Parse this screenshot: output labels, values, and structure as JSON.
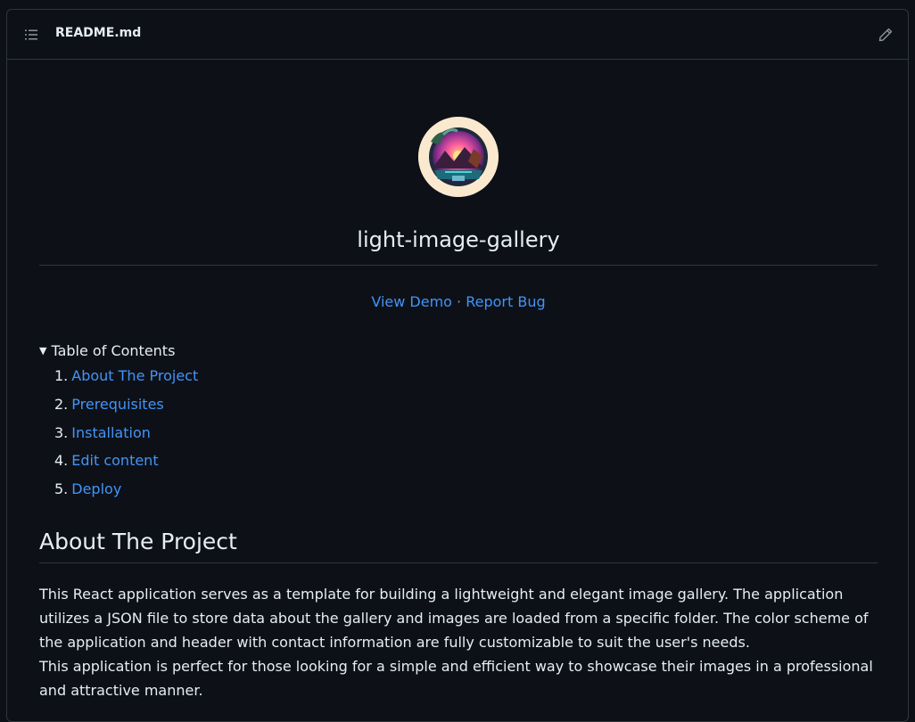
{
  "header": {
    "file_name": "README.md"
  },
  "project": {
    "title": "light-image-gallery",
    "view_demo": "View Demo",
    "separator": " · ",
    "report_bug": "Report Bug"
  },
  "toc": {
    "summary": "Table of Contents",
    "items": [
      {
        "num": "1.",
        "label": "About The Project"
      },
      {
        "num": "2.",
        "label": "Prerequisites"
      },
      {
        "num": "3.",
        "label": "Installation"
      },
      {
        "num": "4.",
        "label": "Edit content"
      },
      {
        "num": "5.",
        "label": "Deploy"
      }
    ]
  },
  "about": {
    "heading": "About The Project",
    "paragraph_1": "This React application serves as a template for building a lightweight and elegant image gallery. The application utilizes a JSON file to store data about the gallery and images are loaded from a specific folder. The color scheme of the application and header with contact information are fully customizable to suit the user's needs.",
    "paragraph_2": "This application is perfect for those looking for a simple and efficient way to showcase their images in a professional and attractive manner."
  },
  "colors": {
    "background": "#0d1117",
    "border": "#30363d",
    "text": "#e6edf3",
    "link": "#4493f8",
    "muted": "#8b949e"
  },
  "icons": {
    "toc": "list-unordered-icon",
    "edit": "pencil-icon",
    "summary": "triangle-down-icon"
  }
}
